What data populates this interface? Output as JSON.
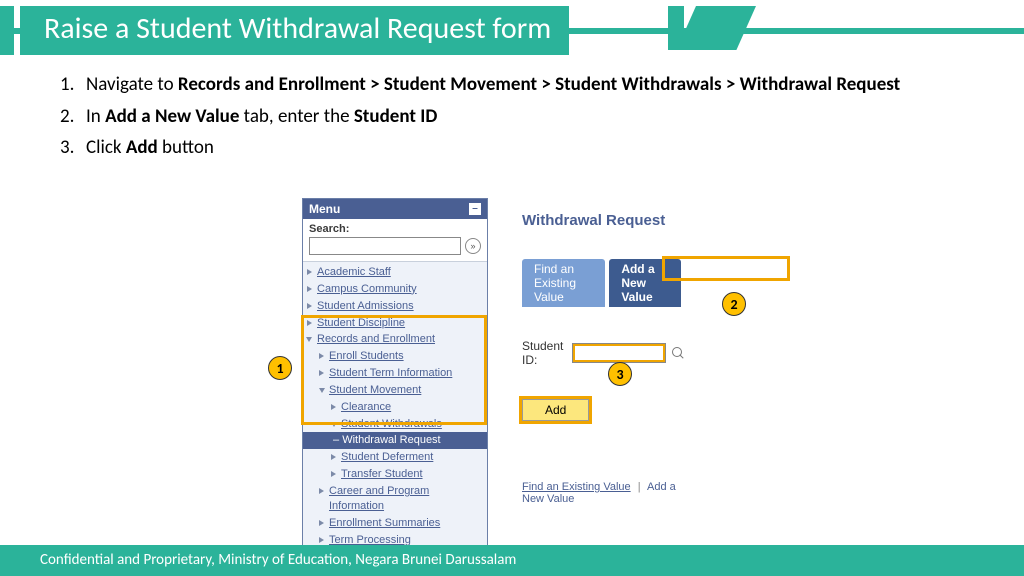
{
  "header": {
    "title": "Raise a Student Withdrawal Request form"
  },
  "instructions": {
    "n1": "1.",
    "t1a": "Navigate to ",
    "t1b": "Records and Enrollment > Student Movement > Student Withdrawals > Withdrawal Request",
    "n2": "2.",
    "t2a": "In ",
    "t2b": "Add a New Value",
    "t2c": " tab, enter the ",
    "t2d": "Student ID",
    "n3": "3.",
    "t3a": "Click ",
    "t3b": "Add",
    "t3c": " button"
  },
  "menu": {
    "title": "Menu",
    "search_label": "Search:",
    "items": {
      "i0": "Academic Staff",
      "i1": "Campus Community",
      "i2": "Student Admissions",
      "i3": "Student Discipline",
      "i4": "Records and Enrollment",
      "i5": "Enroll Students",
      "i6": "Student Term Information",
      "i7": "Student Movement",
      "i8": "Clearance",
      "i9": "Student Withdrawals",
      "i10": "Withdrawal Request",
      "i11": "Student Deferment",
      "i12": "Transfer Student",
      "i13": "Career and Program Information",
      "i14": "Enrollment Summaries",
      "i15": "Term Processing"
    }
  },
  "content": {
    "title": "Withdrawal Request",
    "tab_find": "Find an Existing Value",
    "tab_add": "Add a New Value",
    "field_label": "Student ID:",
    "add_btn": "Add",
    "link_find": "Find an Existing Value",
    "link_sep": "|",
    "link_add": "Add a New Value"
  },
  "callouts": {
    "c1": "1",
    "c2": "2",
    "c3": "3"
  },
  "footer": {
    "text": "Confidential and Proprietary, Ministry of Education, Negara Brunei Darussalam"
  }
}
